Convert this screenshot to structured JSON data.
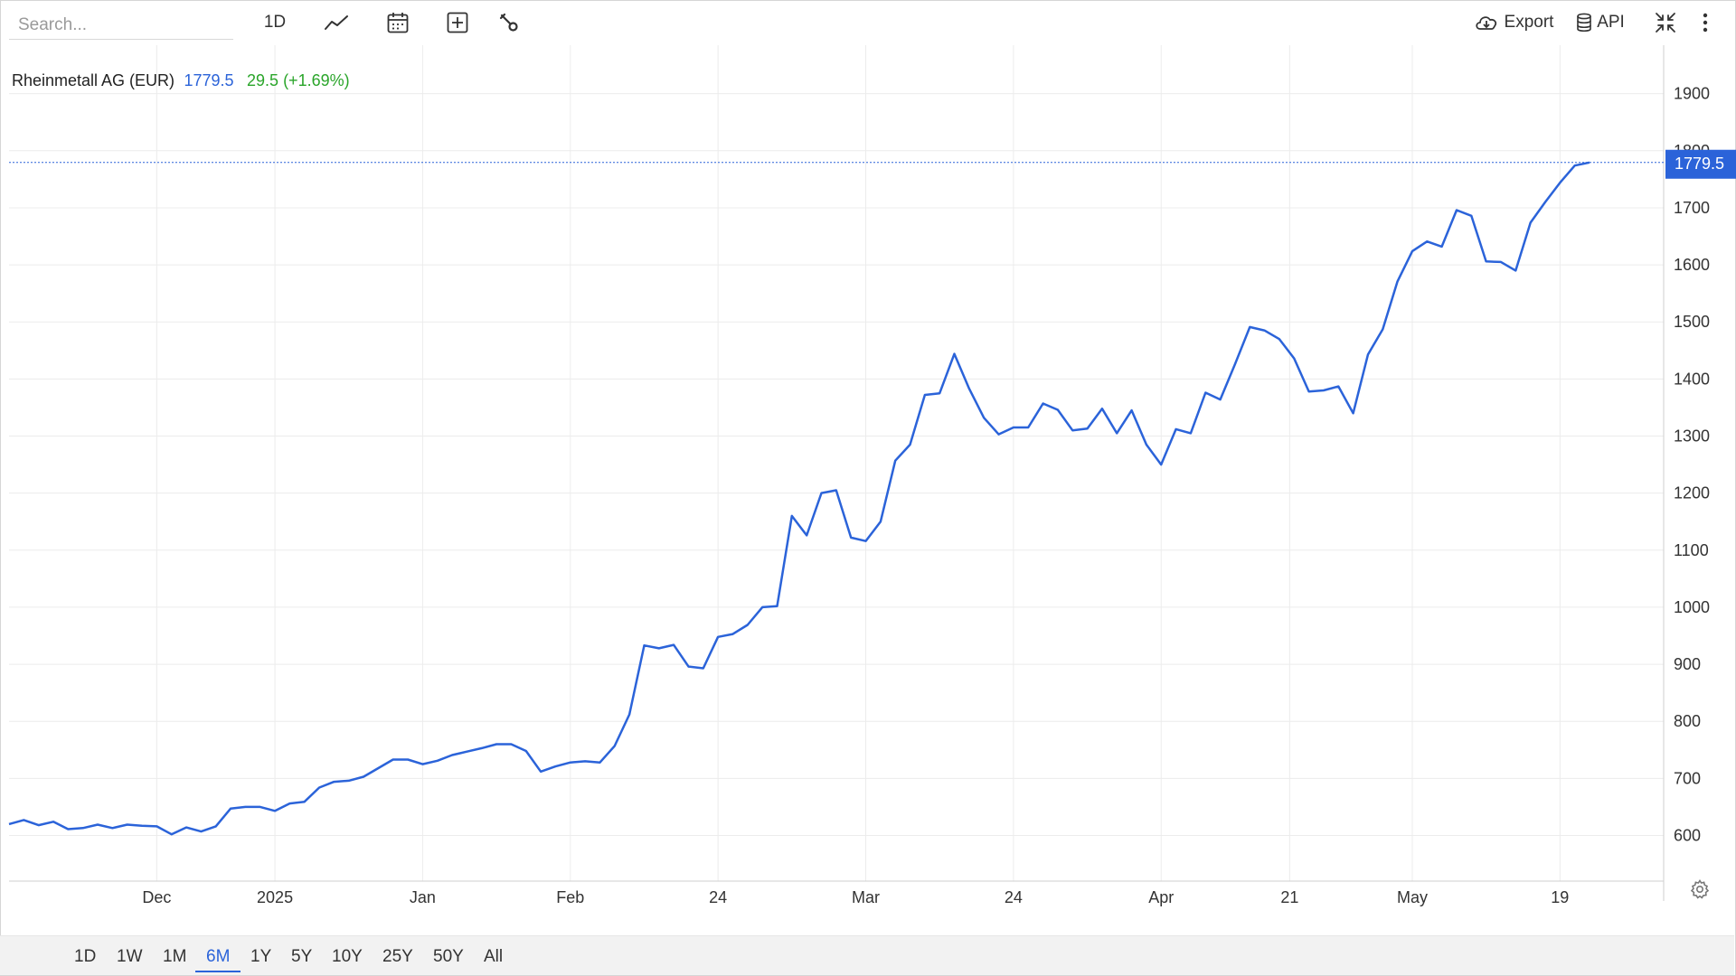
{
  "toolbar": {
    "search_placeholder": "Search...",
    "interval": "1D",
    "export_label": "Export",
    "api_label": "API"
  },
  "legend": {
    "name": "Rheinmetall AG (EUR)",
    "price": "1779.5",
    "change": "29.5 (+1.69%)"
  },
  "ranges": [
    "1D",
    "1W",
    "1M",
    "6M",
    "1Y",
    "5Y",
    "10Y",
    "25Y",
    "50Y",
    "All"
  ],
  "active_range": "6M",
  "colors": {
    "line": "#2b63d9",
    "change_positive": "#2aa52a",
    "price_tag": "#2b63d9",
    "grid": "#ececec"
  },
  "chart_data": {
    "type": "line",
    "title": "Rheinmetall AG (EUR)",
    "xlabel": "",
    "ylabel": "",
    "ylim": [
      520,
      1985
    ],
    "x_ticks": [
      {
        "label": "Dec",
        "index": 10
      },
      {
        "label": "2025",
        "index": 18
      },
      {
        "label": "Jan",
        "index": 28
      },
      {
        "label": "Feb",
        "index": 38
      },
      {
        "label": "24",
        "index": 48
      },
      {
        "label": "Mar",
        "index": 58
      },
      {
        "label": "24",
        "index": 68
      },
      {
        "label": "Apr",
        "index": 78
      },
      {
        "label": "21",
        "index": 86.7
      },
      {
        "label": "May",
        "index": 95
      },
      {
        "label": "19",
        "index": 105
      }
    ],
    "y_ticks": [
      600,
      700,
      800,
      900,
      1000,
      1100,
      1200,
      1300,
      1400,
      1500,
      1600,
      1700,
      1800,
      1900
    ],
    "last_price_label": "1779.5",
    "last_price": 1779.5,
    "grid": true,
    "series": [
      {
        "values": [
          620,
          627,
          618,
          624,
          611,
          613,
          619,
          613,
          619,
          617,
          616,
          602,
          614,
          607,
          616,
          647,
          650,
          650,
          643,
          656,
          659,
          684,
          694,
          696,
          703,
          718,
          733,
          733,
          725,
          731,
          741,
          747,
          753,
          760,
          760,
          748,
          712,
          721,
          728,
          730,
          728,
          757,
          812,
          933,
          928,
          934,
          896,
          893,
          948,
          953,
          969,
          1000,
          1002,
          1160,
          1126,
          1200,
          1205,
          1122,
          1116,
          1150,
          1257,
          1285,
          1372,
          1375,
          1444,
          1383,
          1332,
          1303,
          1315,
          1315,
          1357,
          1346,
          1310,
          1313,
          1348,
          1305,
          1345,
          1285,
          1250,
          1312,
          1305,
          1376,
          1364,
          1426,
          1491,
          1485,
          1470,
          1436,
          1378,
          1380,
          1387,
          1340,
          1443,
          1487,
          1571,
          1624,
          1641,
          1632,
          1696,
          1686,
          1606,
          1605,
          1590,
          1674,
          1710,
          1744,
          1774,
          1779.5
        ]
      }
    ]
  }
}
